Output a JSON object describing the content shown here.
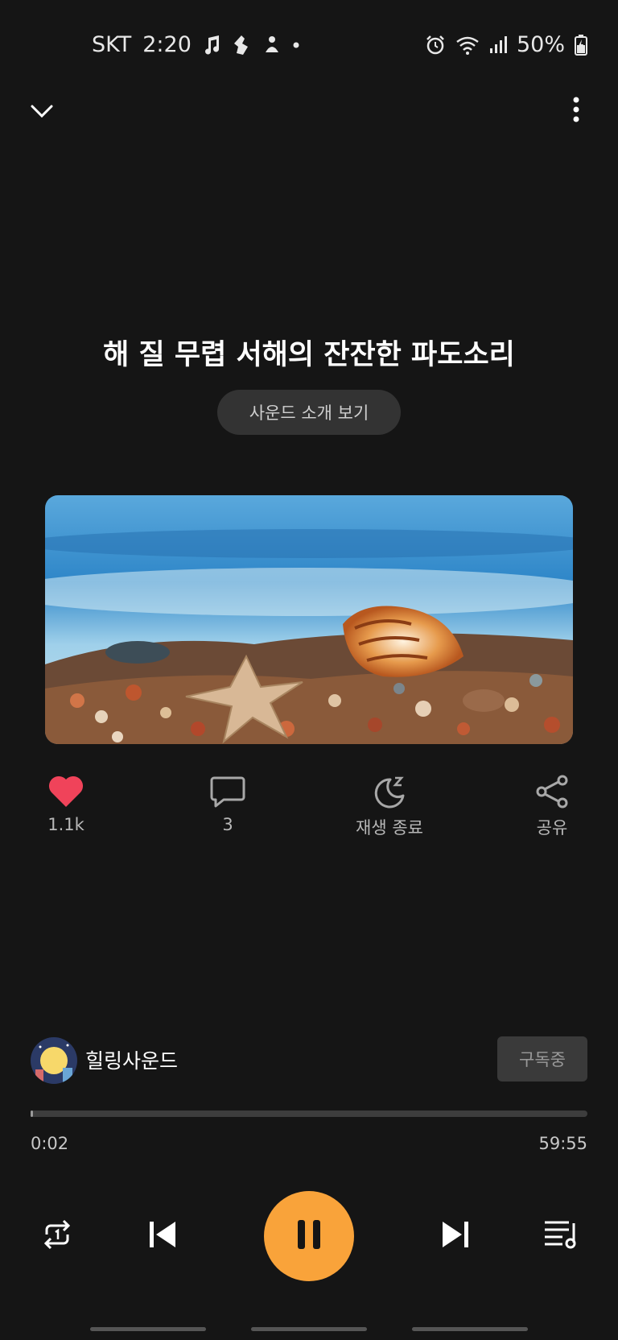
{
  "status_bar": {
    "carrier": "SKT",
    "time": "2:20",
    "battery": "50%"
  },
  "header": {
    "collapse_icon": "chevron-down-icon",
    "menu_icon": "more-vert-icon"
  },
  "track": {
    "title": "해 질 무렵 서해의 잔잔한 파도소리",
    "intro_button": "사운드 소개 보기",
    "artwork_description": "starfish-and-shells-on-beach"
  },
  "actions": {
    "like_count": "1.1k",
    "comment_count": "3",
    "sleep_label": "재생 종료",
    "share_label": "공유",
    "like_color": "#f0435a"
  },
  "channel": {
    "name": "힐링사운드",
    "subscribe_label": "구독중"
  },
  "player": {
    "elapsed": "0:02",
    "remaining": "59:55",
    "progress_fraction": 0.0006,
    "accent_color": "#f9a33a",
    "controls": [
      "repeat-one-icon",
      "previous-icon",
      "pause-icon",
      "next-icon",
      "queue-icon"
    ]
  }
}
